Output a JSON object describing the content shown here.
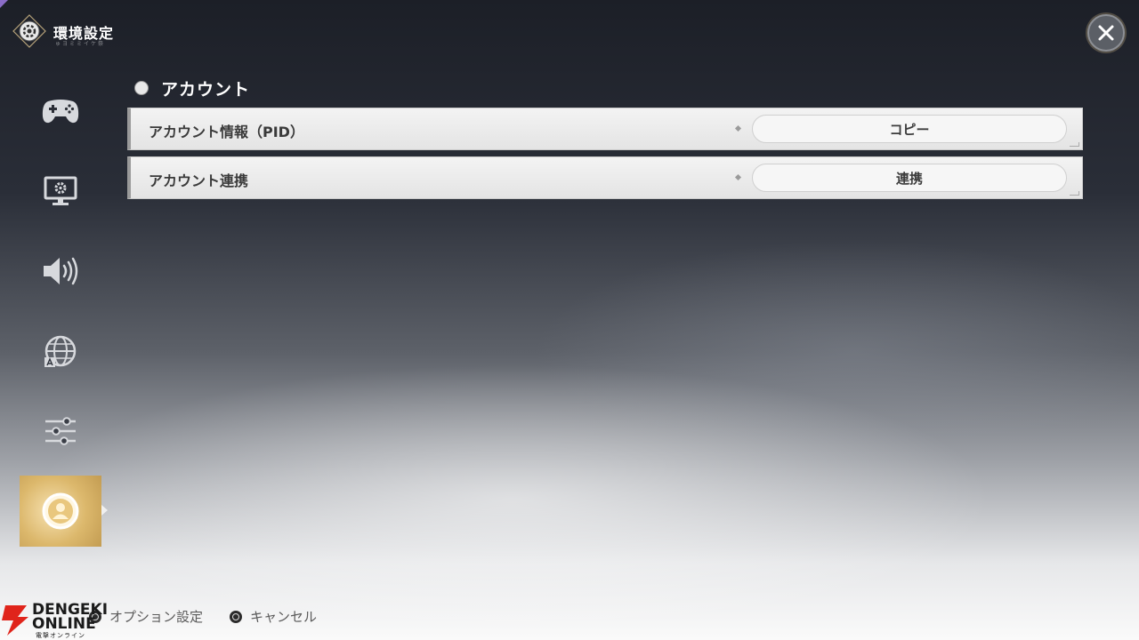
{
  "header": {
    "title": "環境設定",
    "subtitle": "ゅヨミミイケ祭"
  },
  "sidebar": {
    "items": [
      {
        "id": "controller",
        "icon": "gamepad-icon",
        "active": false
      },
      {
        "id": "display",
        "icon": "monitor-settings-icon",
        "active": false
      },
      {
        "id": "audio",
        "icon": "speaker-icon",
        "active": false
      },
      {
        "id": "language",
        "icon": "globe-language-icon",
        "active": false
      },
      {
        "id": "other",
        "icon": "sliders-icon",
        "active": false
      },
      {
        "id": "account",
        "icon": "account-icon",
        "active": true
      }
    ]
  },
  "section": {
    "title": "アカウント",
    "rows": [
      {
        "label": "アカウント情報（PID）",
        "button": "コピー"
      },
      {
        "label": "アカウント連携",
        "button": "連携"
      }
    ]
  },
  "footer": {
    "hints": [
      {
        "icon": "options-button-icon",
        "label": "オプション設定"
      },
      {
        "icon": "circle-button-icon",
        "label": "キャンセル"
      }
    ]
  },
  "watermark": {
    "line1": "DENGEKI",
    "line2": "ONLINE",
    "line3": "電撃オンライン"
  },
  "colors": {
    "accent": "#dcb86c",
    "row_bg": "#e8e8e8",
    "text_dark": "#3a3a3a"
  }
}
